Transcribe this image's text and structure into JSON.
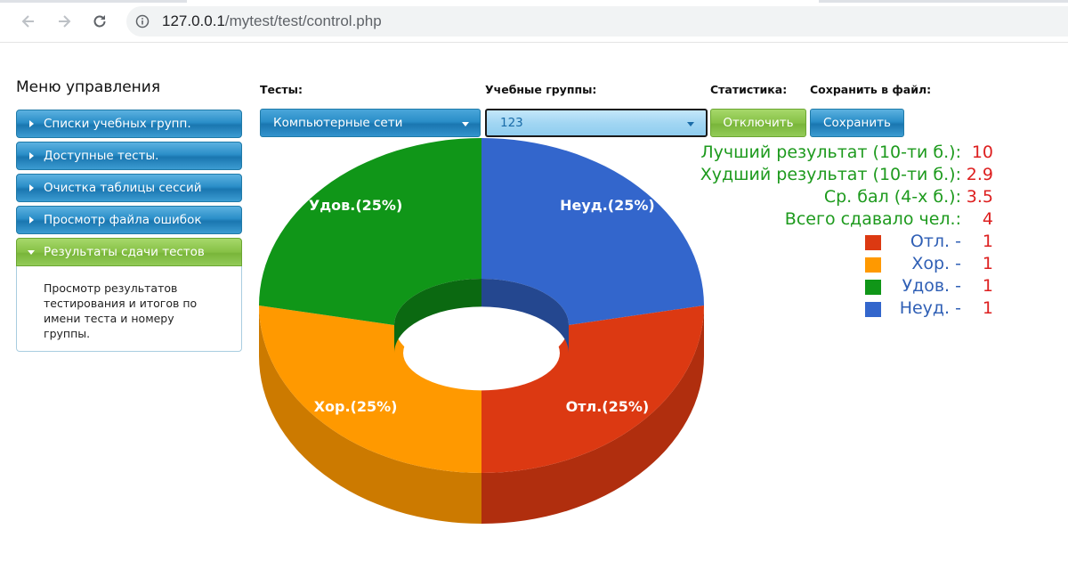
{
  "browser": {
    "url_host": "127.0.0.1",
    "url_path": "/mytest/test/control.php"
  },
  "menu": {
    "title": "Меню управления",
    "items": [
      {
        "label": "Списки учебных групп."
      },
      {
        "label": "Доступные тесты."
      },
      {
        "label": "Очистка таблицы сессий"
      },
      {
        "label": "Просмотр файла ошибок"
      },
      {
        "label": "Результаты сдачи тестов",
        "active": true
      }
    ],
    "active_panel_text": "Просмотр результатов тестирования и итогов по имени теста и номеру группы."
  },
  "controls": {
    "tests_label": "Тесты:",
    "tests_value": "Компьютерные сети",
    "groups_label": "Учебные группы:",
    "groups_value": "123",
    "stats_label": "Статистика:",
    "stats_button": "Отключить",
    "save_label": "Сохранить в файл:",
    "save_button": "Сохранить"
  },
  "stats": {
    "best_label": "Лучший результат (10-ти б.):",
    "best_value": "10",
    "worst_label": "Худший результат (10-ти б.):",
    "worst_value": "2.9",
    "avg_label": "Ср. бал (4-х б.):",
    "avg_value": "3.5",
    "total_label": "Всего сдавало чел.:",
    "total_value": "4",
    "legend": [
      {
        "label": "Отл. -",
        "value": "1",
        "color": "#dc3912"
      },
      {
        "label": "Хор. -",
        "value": "1",
        "color": "#ff9900"
      },
      {
        "label": "Удов. -",
        "value": "1",
        "color": "#109618"
      },
      {
        "label": "Неуд. -",
        "value": "1",
        "color": "#3366cc"
      }
    ]
  },
  "chart_data": {
    "type": "pie",
    "categories": [
      "Неуд.",
      "Отл.",
      "Хор.",
      "Удов."
    ],
    "values": [
      1,
      1,
      1,
      1
    ],
    "labels": [
      "Неуд.(25%)",
      "Отл.(25%)",
      "Хор.(25%)",
      "Удов.(25%)"
    ],
    "colors": [
      "#3366cc",
      "#dc3912",
      "#ff9900",
      "#109618"
    ],
    "donut": true,
    "three_d": true
  }
}
